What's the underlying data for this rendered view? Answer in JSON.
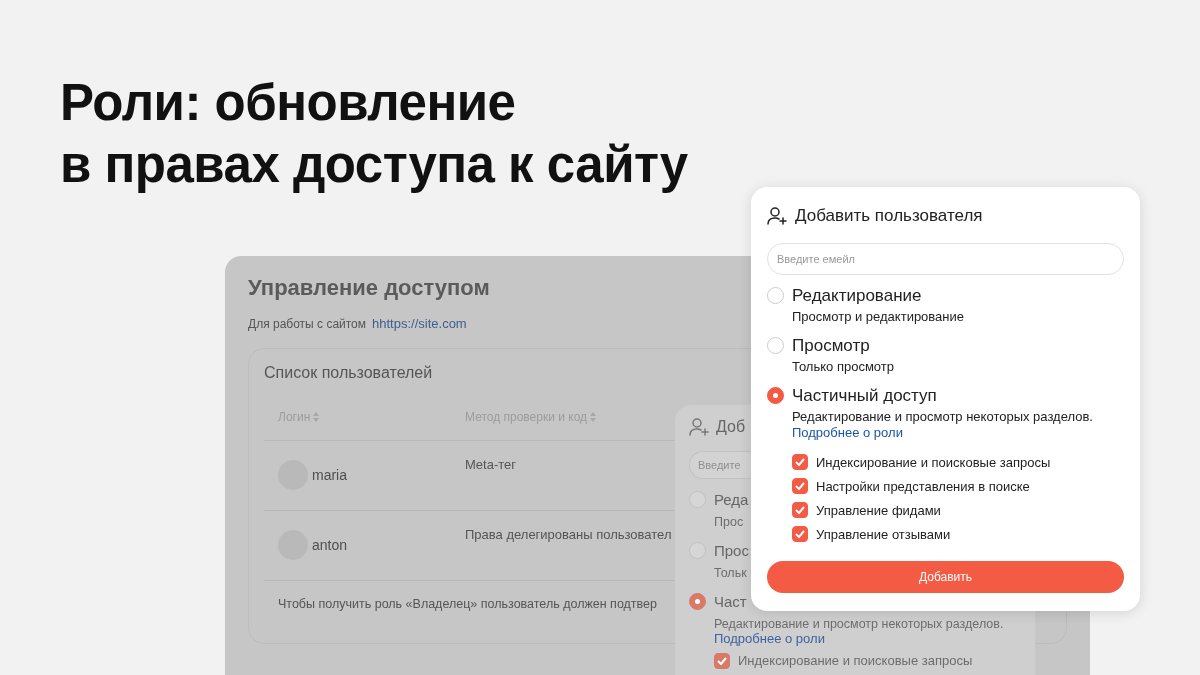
{
  "headline": {
    "lines": [
      "Роли: обновление",
      "в правах доступа к сайту"
    ]
  },
  "access_page": {
    "title": "Управление доступом",
    "subtitle": "Для работы с сайтом",
    "site_link": "hhttps://site.com",
    "users_card": {
      "title": "Список пользователей",
      "columns": [
        "Логин",
        "Метод проверки и код"
      ],
      "rows": [
        {
          "login": "maria",
          "method": "Meta-тег"
        },
        {
          "login": "anton",
          "method": "Права делегированы пользовател"
        }
      ],
      "note": "Чтобы получить роль «Владелец» пользователь должен подтвер"
    }
  },
  "dimmed_dialog": {
    "title": "Доб",
    "email_placeholder": "Введите",
    "roles": [
      {
        "title": "Реда",
        "description": "Прос",
        "selected": false
      },
      {
        "title": "Прос",
        "description": "Тольк",
        "selected": false
      },
      {
        "title": "Част",
        "description": "Редактирование и просмотр некоторых разделов.",
        "link": "Подробнее о роли",
        "selected": true,
        "permissions": [
          {
            "label": "Индексирование и поисковые запросы",
            "checked": true
          }
        ]
      }
    ]
  },
  "dialog": {
    "title": "Добавить пользователя",
    "email_placeholder": "Введите емейл",
    "roles": [
      {
        "title": "Редактирование",
        "description": "Просмотр и редактирование",
        "selected": false
      },
      {
        "title": "Просмотр",
        "description": "Только просмотр",
        "selected": false
      },
      {
        "title": "Частичный доступ",
        "description": "Редактирование и просмотр некоторых разделов.",
        "link": "Подробнее о роли",
        "selected": true,
        "permissions": [
          {
            "label": "Индексирование и поисковые запросы",
            "checked": true
          },
          {
            "label": "Настройки представления в поиске",
            "checked": true
          },
          {
            "label": "Управление фидами",
            "checked": true
          },
          {
            "label": "Управление отзывами",
            "checked": true
          }
        ]
      }
    ],
    "submit": "Добавить"
  }
}
